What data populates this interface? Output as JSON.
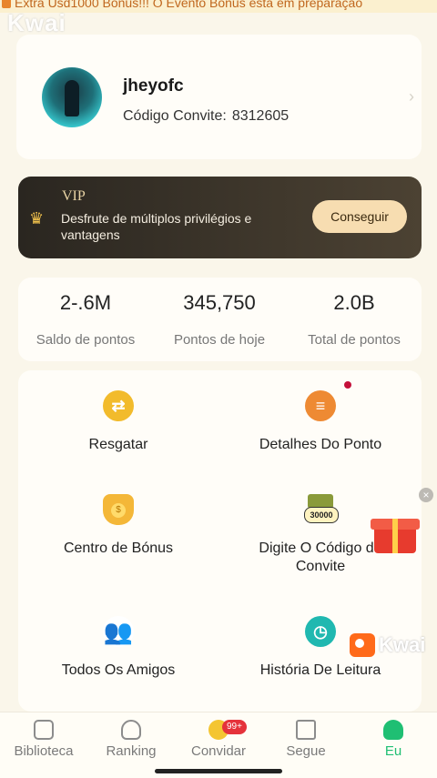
{
  "banner": {
    "text": "Extra Usd1000 Bonus!!! O Evento Bonus está em preparação"
  },
  "watermark": {
    "top": "Kwai",
    "bottom": "Kwai"
  },
  "profile": {
    "username": "jheyofc",
    "invite_label": "Código Convite:",
    "invite_code": "8312605"
  },
  "vip": {
    "title": "VIP",
    "description": "Desfrute de múltiplos privilégios e vantagens",
    "button": "Conseguir"
  },
  "stats": [
    {
      "value": "2‑.6M",
      "label": "Saldo de pontos"
    },
    {
      "value": "345,750",
      "label": "Pontos de hoje"
    },
    {
      "value": "2.0B",
      "label": "Total de pontos"
    }
  ],
  "menu": [
    {
      "label": "Resgatar",
      "icon": "exchange-icon"
    },
    {
      "label": "Detalhes Do Ponto",
      "icon": "coins-stack-icon"
    },
    {
      "label": "Centro de Bónus",
      "icon": "money-bag-icon"
    },
    {
      "label": "Digite O Código de Convite",
      "icon": "invite-code-icon",
      "badge_text": "30000"
    },
    {
      "label": "Todos Os Amigos",
      "icon": "friends-icon"
    },
    {
      "label": "História De Leitura",
      "icon": "clock-icon"
    }
  ],
  "tabs": [
    {
      "label": "Biblioteca",
      "icon": "library-icon"
    },
    {
      "label": "Ranking",
      "icon": "trophy-icon"
    },
    {
      "label": "Convidar",
      "icon": "coin-icon",
      "badge": "99+"
    },
    {
      "label": "Segue",
      "icon": "add-bookmark-icon"
    },
    {
      "label": "Eu",
      "icon": "user-icon",
      "active": true
    }
  ],
  "colors": {
    "accent": "#1fbf73",
    "vip_bg": "#2a2620",
    "vip_button": "#f7ddb1",
    "badge": "#e5323b",
    "notification_dot": "#c4103a"
  }
}
